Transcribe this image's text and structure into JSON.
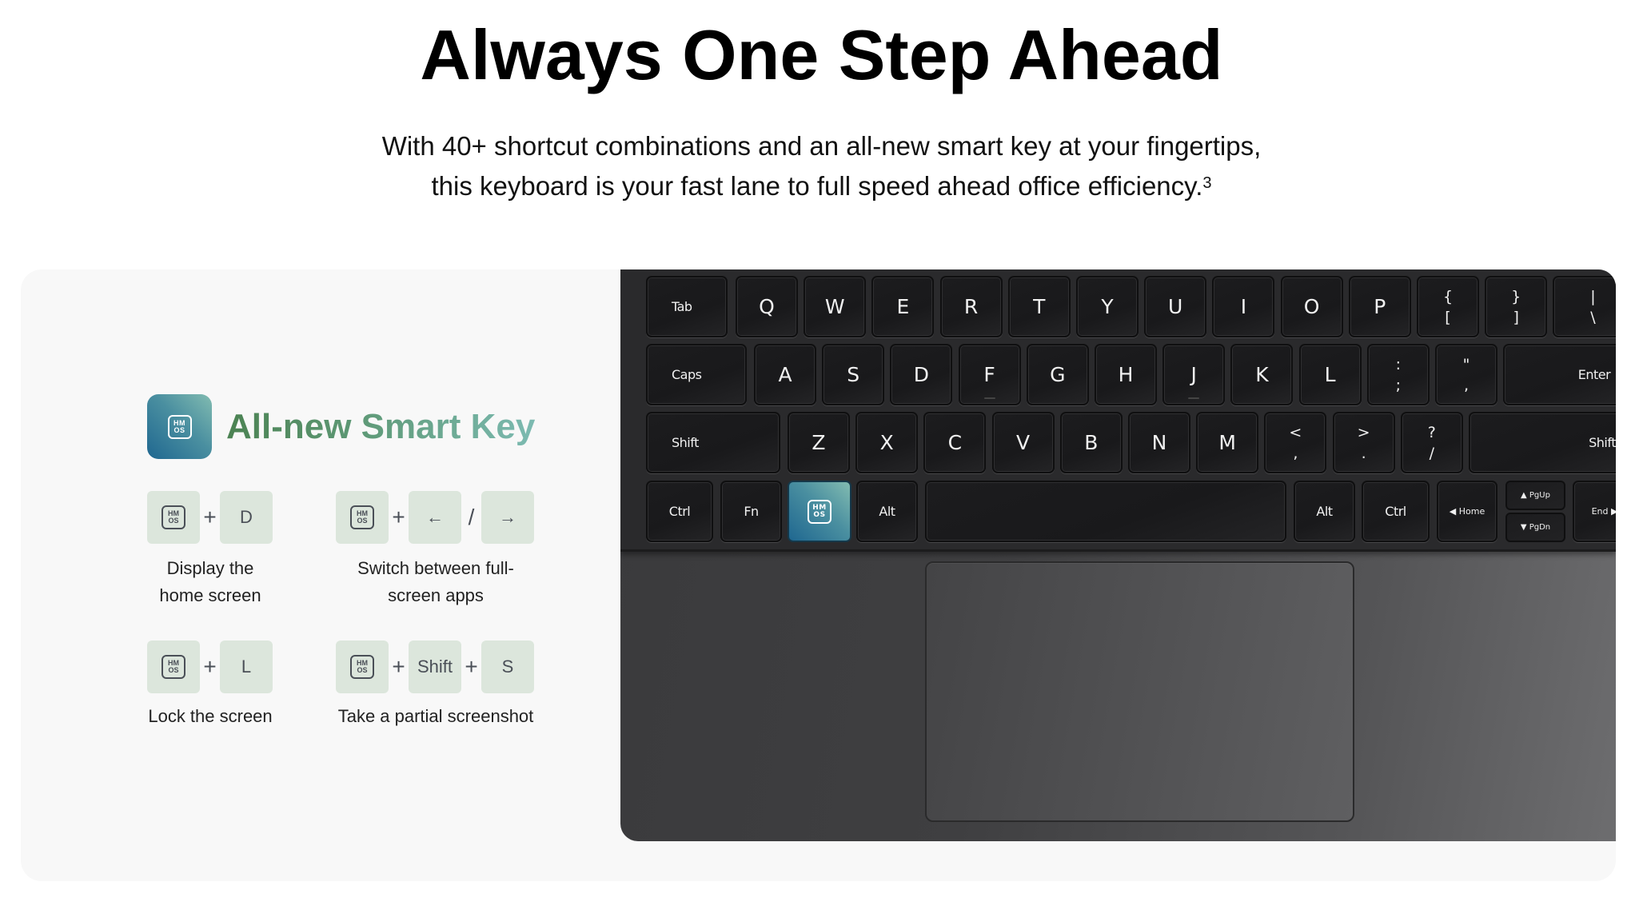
{
  "header": {
    "title": "Always One Step Ahead",
    "subtitle_line1": "With 40+ shortcut combinations and an all-new smart key at your fingertips,",
    "subtitle_line2": "this keyboard is your fast lane to full speed ahead office efficiency.",
    "footnote": "3"
  },
  "smart_key": {
    "icon": "hmos-icon",
    "icon_text_top": "HM",
    "icon_text_bottom": "OS",
    "title": "All-new Smart Key",
    "colors": {
      "icon_gradient_start": "#1f6790",
      "icon_gradient_end": "#82bcb1",
      "title_gradient_start": "#4b8252",
      "title_gradient_end": "#7cbab1",
      "keycap_bg": "#dce6dc"
    }
  },
  "shortcuts": [
    {
      "keys": [
        "hmos",
        "D"
      ],
      "separators": [
        "+"
      ],
      "description_line1": "Display the",
      "description_line2": "home screen"
    },
    {
      "keys": [
        "hmos",
        "←",
        "→"
      ],
      "separators": [
        "+",
        "/"
      ],
      "description_line1": "Switch between full-",
      "description_line2": "screen apps"
    },
    {
      "keys": [
        "hmos",
        "L"
      ],
      "separators": [
        "+"
      ],
      "description_line1": "Lock the screen",
      "description_line2": ""
    },
    {
      "keys": [
        "hmos",
        "Shift",
        "S"
      ],
      "separators": [
        "+",
        "+"
      ],
      "description_line1": "Take a partial screenshot",
      "description_line2": ""
    }
  ],
  "keyboard": {
    "row1": [
      "Tab",
      "Q",
      "W",
      "E",
      "R",
      "T",
      "Y",
      "U",
      "I",
      "O",
      "P"
    ],
    "row1_dual": [
      [
        "{",
        "["
      ],
      [
        "}",
        "]"
      ],
      [
        "|",
        "\\"
      ]
    ],
    "row2": [
      "Caps",
      "A",
      "S",
      "D",
      "F",
      "G",
      "H",
      "J",
      "K",
      "L"
    ],
    "row2_dual": [
      [
        ":",
        ";"
      ],
      [
        "\"",
        ","
      ]
    ],
    "row2_end": "Enter",
    "row3": [
      "Shift",
      "Z",
      "X",
      "C",
      "V",
      "B",
      "N",
      "M"
    ],
    "row3_dual": [
      [
        "<",
        ","
      ],
      [
        ">",
        "."
      ],
      [
        "?",
        "/"
      ]
    ],
    "row3_end": "Shift",
    "row4": [
      "Ctrl",
      "Fn",
      "hmos",
      "Alt",
      "",
      "Alt",
      "Ctrl",
      "◀ Home",
      "▲ PgUp",
      "▼ PgDn",
      "End ▶"
    ]
  }
}
